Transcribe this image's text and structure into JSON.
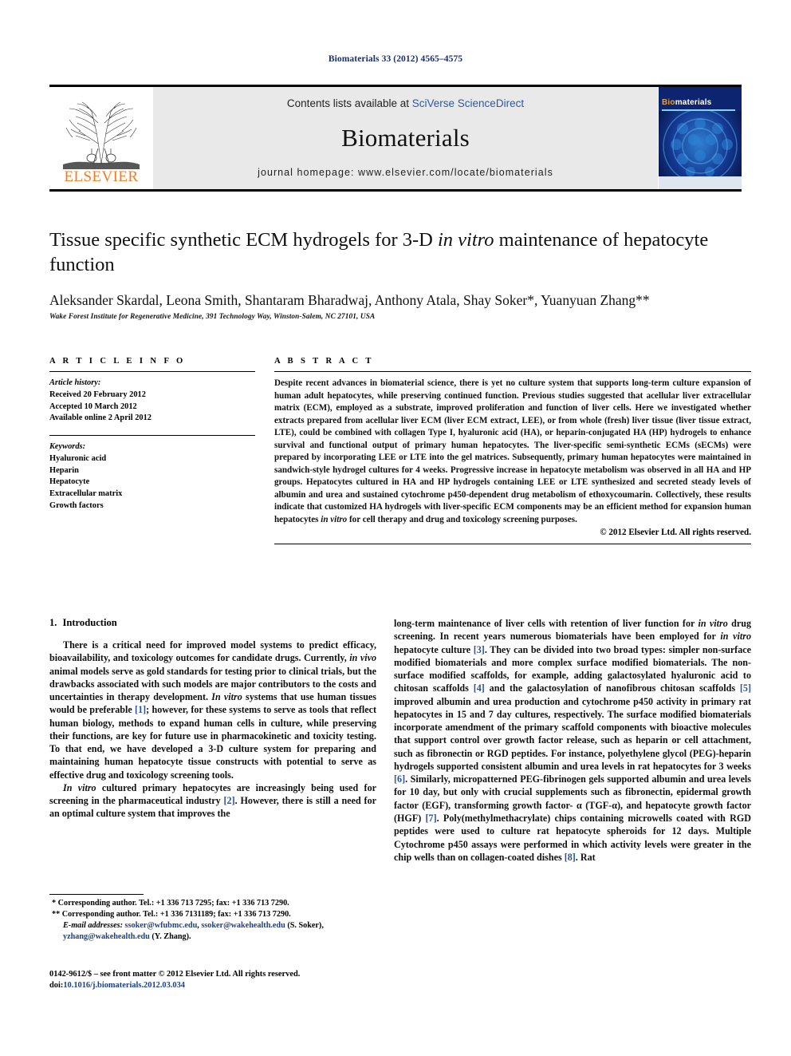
{
  "running_head": "Biomaterials 33 (2012) 4565–4575",
  "masthead": {
    "publisher_name": "ELSEVIER",
    "contents_prefix": "Contents lists available at ",
    "contents_link": "SciVerse ScienceDirect",
    "journal_name": "Biomaterials",
    "homepage": "journal homepage: www.elsevier.com/locate/biomaterials",
    "cover_title_bio": "Bio",
    "cover_title_materials": "materials"
  },
  "article": {
    "title_part1": "Tissue specific synthetic ECM hydrogels for 3-D ",
    "title_italic": "in vitro",
    "title_part2": " maintenance of hepatocyte function",
    "authors": "Aleksander Skardal, Leona Smith, Shantaram Bharadwaj, Anthony Atala, Shay Soker*, Yuanyuan Zhang**",
    "affiliation": "Wake Forest Institute for Regenerative Medicine, 391 Technology Way, Winston-Salem, NC 27101, USA"
  },
  "article_info": {
    "heading": "A R T I C L E  I N F O",
    "history_label": "Article history:",
    "history": [
      "Received 20 February 2012",
      "Accepted 10 March 2012",
      "Available online 2 April 2012"
    ],
    "keywords_label": "Keywords:",
    "keywords": [
      "Hyaluronic acid",
      "Heparin",
      "Hepatocyte",
      "Extracellular matrix",
      "Growth factors"
    ]
  },
  "abstract": {
    "heading": "A B S T R A C T",
    "text_1": "Despite recent advances in biomaterial science, there is yet no culture system that supports long-term culture expansion of human adult hepatocytes, while preserving continued function. Previous studies suggested that acellular liver extracellular matrix (ECM), employed as a substrate, improved proliferation and function of liver cells. Here we investigated whether extracts prepared from acellular liver ECM (liver ECM extract, LEE), or from whole (fresh) liver tissue (liver tissue extract, LTE), could be combined with collagen Type I, hyaluronic acid (HA), or heparin-conjugated HA (HP) hydrogels to enhance survival and functional output of primary human hepatocytes. The liver-specific semi-synthetic ECMs (sECMs) were prepared by incorporating LEE or LTE into the gel matrices. Subsequently, primary human hepatocytes were maintained in sandwich-style hydrogel cultures for 4 weeks. Progressive increase in hepatocyte metabolism was observed in all HA and HP groups. Hepatocytes cultured in HA and HP hydrogels containing LEE or LTE synthesized and secreted steady levels of albumin and urea and sustained cytochrome p450-dependent drug metabolism of ethoxycoumarin. Collectively, these results indicate that customized HA hydrogels with liver-specific ECM components may be an efficient method for expansion human hepatocytes ",
    "text_italic": "in vitro",
    "text_2": " for cell therapy and drug and toxicology screening purposes.",
    "copyright": "© 2012 Elsevier Ltd. All rights reserved."
  },
  "introduction": {
    "number": "1.",
    "heading": "Introduction",
    "left_p1_a": "There is a critical need for improved model systems to predict efficacy, bioavailability, and toxicology outcomes for candidate drugs. Currently, ",
    "left_p1_i1": "in vivo",
    "left_p1_b": " animal models serve as gold standards for testing prior to clinical trials, but the drawbacks associated with such models are major contributors to the costs and uncertainties in therapy development. ",
    "left_p1_i2": "In vitro",
    "left_p1_c": " systems that use human tissues would be preferable ",
    "left_p1_ref1": "[1]",
    "left_p1_d": "; however, for these systems to serve as tools that reflect human biology, methods to expand human cells in culture, while preserving their functions, are key for future use in pharmacokinetic and toxicity testing. To that end, we have developed a 3-D culture system for preparing and maintaining human hepatocyte tissue constructs with potential to serve as effective drug and toxicology screening tools.",
    "left_p2_i1": "In vitro",
    "left_p2_a": " cultured primary hepatocytes are increasingly being used for screening in the pharmaceutical industry ",
    "left_p2_ref1": "[2]",
    "left_p2_b": ". However, there is still a need for an optimal culture system that improves the",
    "right_a": "long-term maintenance of liver cells with retention of liver function for ",
    "right_i1": "in vitro",
    "right_b": " drug screening. In recent years numerous biomaterials have been employed for ",
    "right_i2": "in vitro",
    "right_c": " hepatocyte culture ",
    "right_ref3": "[3]",
    "right_d": ". They can be divided into two broad types: simpler non-surface modified biomaterials and more complex surface modified biomaterials. The non-surface modified scaffolds, for example, adding galactosylated hyaluronic acid to chitosan scaffolds ",
    "right_ref4": "[4]",
    "right_e": " and the galactosylation of nanofibrous chitosan scaffolds ",
    "right_ref5": "[5]",
    "right_f": " improved albumin and urea production and cytochrome p450 activity in primary rat hepatocytes in 15 and 7 day cultures, respectively. The surface modified biomaterials incorporate amendment of the primary scaffold components with bioactive molecules that support control over growth factor release, such as heparin or cell attachment, such as fibronectin or RGD peptides. For instance, polyethylene glycol (PEG)-heparin hydrogels supported consistent albumin and urea levels in rat hepatocytes for 3 weeks ",
    "right_ref6": "[6]",
    "right_g": ". Similarly, micropatterned PEG-fibrinogen gels supported albumin and urea levels for 10 day, but only with crucial supplements such as fibronectin, epidermal growth factor (EGF), transforming growth factor- α (TGF-α), and hepatocyte growth factor (HGF) ",
    "right_ref7": "[7]",
    "right_h": ". Poly(methylmethacrylate) chips containing microwells coated with RGD peptides were used to culture rat hepatocyte spheroids for 12 days. Multiple Cytochrome p450 assays were performed in which activity levels were greater in the chip wells than on collagen-coated dishes ",
    "right_ref8": "[8]",
    "right_i": ". Rat"
  },
  "footnotes": {
    "line1": "* Corresponding author. Tel.: +1 336 713 7295; fax: +1 336 713 7290.",
    "line2": "** Corresponding author. Tel.: +1 336 7131189; fax: +1 336 713 7290.",
    "email_label": "E-mail addresses:",
    "email1": "ssoker@wfubmc.edu",
    "email2": "ssoker@wakehealth.edu",
    "email_name1": "(S. Soker),",
    "email3": "yzhang@wakehealth.edu",
    "email_name2": "(Y. Zhang)."
  },
  "imprint": {
    "issn_line": "0142-9612/$ – see front matter © 2012 Elsevier Ltd. All rights reserved.",
    "doi_label": "doi:",
    "doi_value": "10.1016/j.biomaterials.2012.03.034"
  },
  "colors": {
    "running_head": "#1a2f6b",
    "link": "#2b59a8",
    "reference": "#2b4fa2",
    "elsevier_orange": "#f47b20",
    "masthead_grey": "#e9e9e9",
    "cover_blue": "#0b1f6b"
  }
}
